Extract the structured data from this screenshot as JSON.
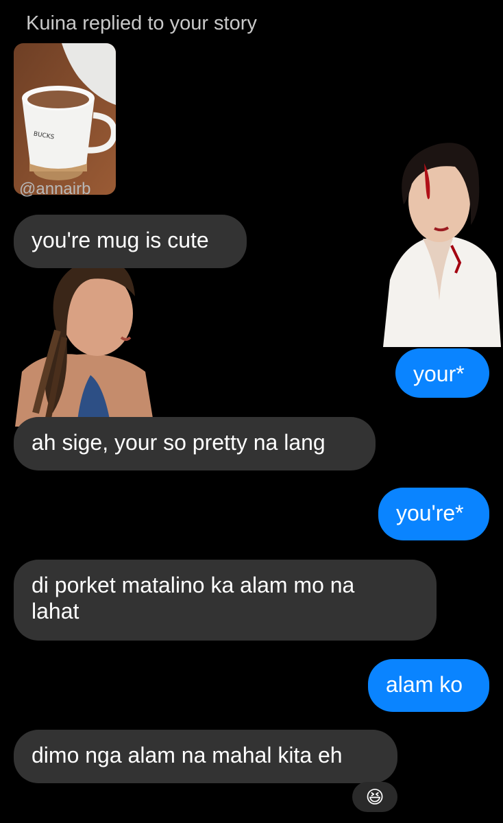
{
  "story": {
    "header": "Kuina replied to your story",
    "handle": "@annairb"
  },
  "messages": [
    {
      "side": "in",
      "text": "you're mug is cute"
    },
    {
      "side": "out",
      "text": "your*"
    },
    {
      "side": "in",
      "text": "ah sige, your so pretty na lang"
    },
    {
      "side": "out",
      "text": "you're*"
    },
    {
      "side": "in",
      "text": "di porket matalino ka alam mo na lahat"
    },
    {
      "side": "out",
      "text": "alam ko"
    },
    {
      "side": "in",
      "text": "dimo nga alam na mahal kita eh"
    }
  ],
  "reaction": {
    "emoji": "😆"
  },
  "colors": {
    "incoming": "#333333",
    "outgoing": "#0a84ff",
    "background": "#000000"
  }
}
